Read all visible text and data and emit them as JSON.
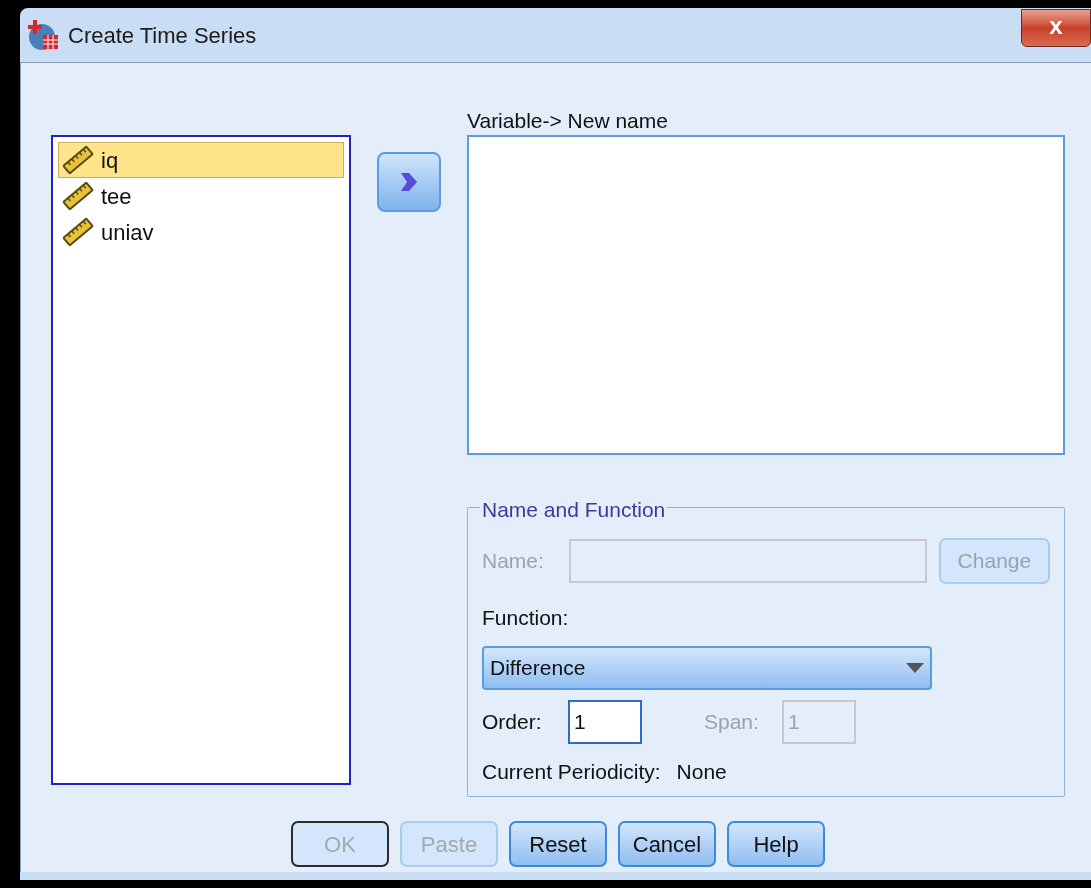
{
  "window": {
    "title": "Create Time Series",
    "close": "x"
  },
  "variables": [
    {
      "name": "iq",
      "selected": true
    },
    {
      "name": "tee",
      "selected": false
    },
    {
      "name": "uniav",
      "selected": false
    }
  ],
  "target": {
    "label": "Variable-> New name"
  },
  "name_and_function": {
    "title": "Name and Function",
    "name": {
      "label": "Name:",
      "disabled": true
    },
    "change": {
      "label": "Change",
      "disabled": true
    },
    "function": {
      "label": "Function:",
      "value": "Difference"
    },
    "order": {
      "label": "Order:",
      "value": "1",
      "disabled": false
    },
    "span": {
      "label": "Span:",
      "value": "1",
      "disabled": true
    },
    "periodicity": {
      "label": "Current Periodicity:",
      "value": "None"
    }
  },
  "buttons": [
    {
      "label": "OK",
      "disabled": true,
      "default": true
    },
    {
      "label": "Paste",
      "disabled": true,
      "default": false
    },
    {
      "label": "Reset",
      "disabled": false,
      "default": false
    },
    {
      "label": "Cancel",
      "disabled": false,
      "default": false
    },
    {
      "label": "Help",
      "disabled": false,
      "default": false
    }
  ]
}
